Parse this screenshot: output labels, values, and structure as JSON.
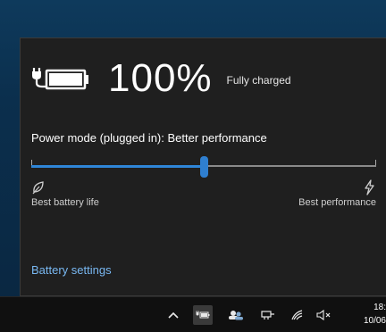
{
  "battery": {
    "percent_text": "100%",
    "status_text": "Fully charged",
    "charge_fraction": 1.0
  },
  "power_mode": {
    "label": "Power mode (plugged in): Better performance",
    "slider_value_fraction": 0.5,
    "tick_fractions": [
      0,
      0.5,
      1
    ],
    "left_label": "Best battery life",
    "right_label": "Best performance",
    "left_icon": "leaf-battery-saver-icon",
    "right_icon": "lightning-bolt-icon"
  },
  "links": {
    "battery_settings": "Battery settings"
  },
  "taskbar": {
    "tray_icons": [
      "chevron-up-icon",
      "battery-plug-icon",
      "people-icon",
      "network-icon",
      "pen-ink-icon",
      "volume-muted-icon"
    ],
    "clock_time": "18:",
    "clock_date": "10/06"
  },
  "colors": {
    "accent": "#2f86d8",
    "link": "#79b8f2",
    "flyout_bg": "#1f1f1f",
    "taskbar_bg": "#101010"
  }
}
